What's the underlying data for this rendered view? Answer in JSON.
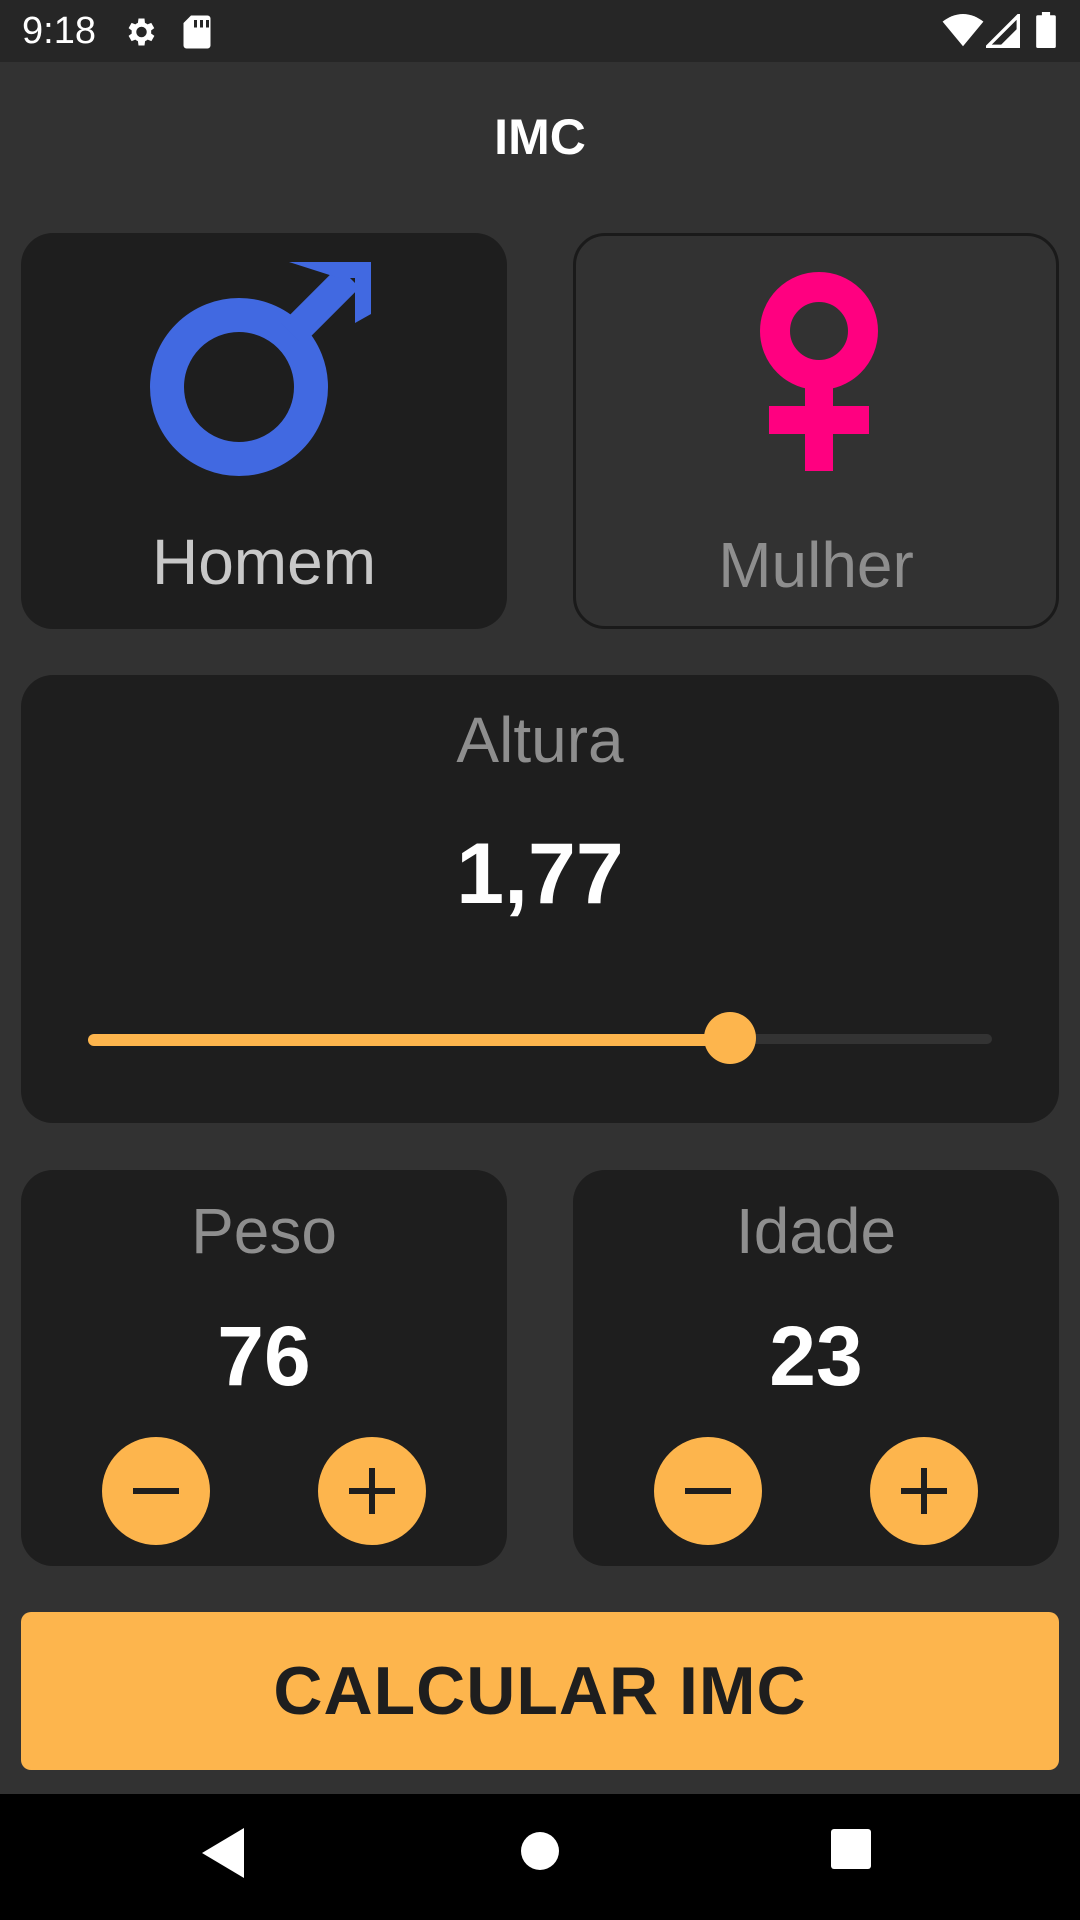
{
  "status_bar": {
    "time": "9:18",
    "icons": [
      "settings-icon",
      "sd-card-icon",
      "wifi-icon",
      "signal-icon",
      "battery-icon"
    ]
  },
  "app_bar": {
    "title": "IMC"
  },
  "gender": {
    "male": {
      "label": "Homem",
      "icon": "male-symbol-icon",
      "color": "#4169e1",
      "selected": true
    },
    "female": {
      "label": "Mulher",
      "icon": "female-symbol-icon",
      "color": "#ff0080",
      "selected": false
    }
  },
  "height": {
    "title": "Altura",
    "value": "1,77",
    "slider_fraction": 0.71
  },
  "weight": {
    "title": "Peso",
    "value": "76",
    "minus_icon": "minus-icon",
    "plus_icon": "plus-icon"
  },
  "age": {
    "title": "Idade",
    "value": "23",
    "minus_icon": "minus-icon",
    "plus_icon": "plus-icon"
  },
  "action": {
    "label": "CALCULAR IMC"
  },
  "colors": {
    "background": "#323232",
    "card": "#1e1e1e",
    "accent": "#fdb54d",
    "muted_text": "#8e8e8e"
  },
  "nav_bar": {
    "buttons": [
      "back-icon",
      "home-icon",
      "recents-icon"
    ]
  }
}
